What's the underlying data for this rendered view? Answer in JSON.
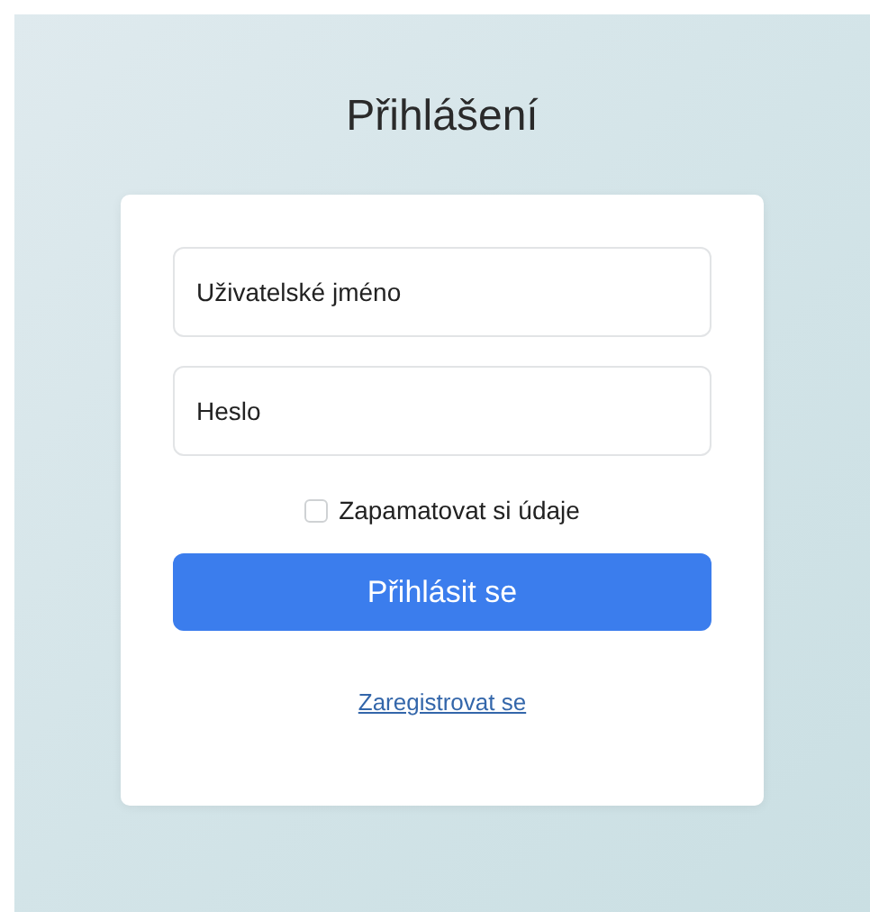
{
  "title": "Přihlášení",
  "fields": [
    {
      "placeholder": "Uživatelské jméno"
    },
    {
      "placeholder": "Heslo"
    }
  ],
  "remember": {
    "label": "Zapamatovat si údaje",
    "checked": false
  },
  "submit": {
    "label": "Přihlásit se"
  },
  "register_link": {
    "label": "Zaregistrovat se"
  }
}
